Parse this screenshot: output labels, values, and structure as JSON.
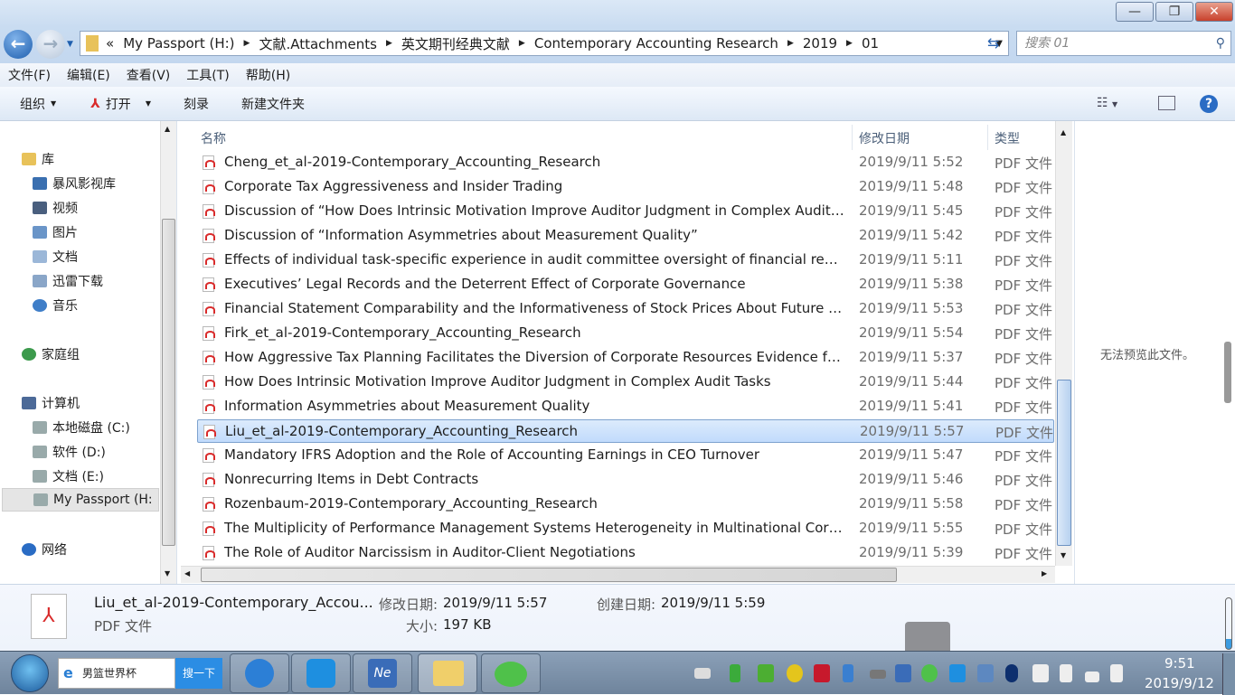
{
  "address": {
    "parts": [
      "«",
      "My Passport (H:)",
      "文献.Attachments",
      "英文期刊经典文献",
      "Contemporary Accounting Research",
      "2019",
      "01"
    ],
    "search_placeholder": "搜索 01"
  },
  "menu": [
    "文件(F)",
    "编辑(E)",
    "查看(V)",
    "工具(T)",
    "帮助(H)"
  ],
  "toolbar": {
    "organize": "组织",
    "open": "打开",
    "burn": "刻录",
    "new_folder": "新建文件夹"
  },
  "nav": {
    "library": "库",
    "lib_items": [
      "暴风影视库",
      "视频",
      "图片",
      "文档",
      "迅雷下载",
      "音乐"
    ],
    "homegroup": "家庭组",
    "computer": "计算机",
    "drives": [
      "本地磁盘 (C:)",
      "软件 (D:)",
      "文档 (E:)",
      "My Passport (H:"
    ],
    "network": "网络"
  },
  "columns": {
    "name": "名称",
    "date": "修改日期",
    "type": "类型"
  },
  "files": [
    {
      "name": "Cheng_et_al-2019-Contemporary_Accounting_Research",
      "date": "2019/9/11 5:52",
      "type": "PDF 文件"
    },
    {
      "name": "Corporate Tax Aggressiveness and Insider Trading",
      "date": "2019/9/11 5:48",
      "type": "PDF 文件"
    },
    {
      "name": "Discussion of “How Does Intrinsic Motivation Improve Auditor Judgment in Complex Audit ...",
      "date": "2019/9/11 5:45",
      "type": "PDF 文件"
    },
    {
      "name": "Discussion of “Information Asymmetries about Measurement Quality”",
      "date": "2019/9/11 5:42",
      "type": "PDF 文件"
    },
    {
      "name": "Effects of individual task-specific experience in audit committee oversight of financial reporti...",
      "date": "2019/9/11 5:11",
      "type": "PDF 文件"
    },
    {
      "name": "Executives’ Legal Records and the Deterrent Effect of Corporate Governance",
      "date": "2019/9/11 5:38",
      "type": "PDF 文件"
    },
    {
      "name": "Financial Statement Comparability and the Informativeness of Stock Prices About Future Earn...",
      "date": "2019/9/11 5:53",
      "type": "PDF 文件"
    },
    {
      "name": "Firk_et_al-2019-Contemporary_Accounting_Research",
      "date": "2019/9/11 5:54",
      "type": "PDF 文件"
    },
    {
      "name": "How Aggressive Tax Planning Facilitates the Diversion of Corporate Resources Evidence fro...",
      "date": "2019/9/11 5:37",
      "type": "PDF 文件"
    },
    {
      "name": "How Does Intrinsic Motivation Improve Auditor Judgment in Complex Audit Tasks",
      "date": "2019/9/11 5:44",
      "type": "PDF 文件"
    },
    {
      "name": "Information Asymmetries about Measurement Quality",
      "date": "2019/9/11 5:41",
      "type": "PDF 文件"
    },
    {
      "name": "Liu_et_al-2019-Contemporary_Accounting_Research",
      "date": "2019/9/11 5:57",
      "type": "PDF 文件",
      "selected": true
    },
    {
      "name": "Mandatory IFRS Adoption and the Role of Accounting Earnings in CEO Turnover",
      "date": "2019/9/11 5:47",
      "type": "PDF 文件"
    },
    {
      "name": "Nonrecurring Items in Debt Contracts",
      "date": "2019/9/11 5:46",
      "type": "PDF 文件"
    },
    {
      "name": "Rozenbaum-2019-Contemporary_Accounting_Research",
      "date": "2019/9/11 5:58",
      "type": "PDF 文件"
    },
    {
      "name": "The Multiplicity of Performance Management Systems Heterogeneity in Multinational Corpo...",
      "date": "2019/9/11 5:55",
      "type": "PDF 文件"
    },
    {
      "name": "The Role of Auditor Narcissism in Auditor-Client Negotiations",
      "date": "2019/9/11 5:39",
      "type": "PDF 文件"
    }
  ],
  "preview": {
    "message": "无法预览此文件。"
  },
  "details": {
    "filename": "Liu_et_al-2019-Contemporary_Accou...",
    "filetype": "PDF 文件",
    "modified_label": "修改日期:",
    "modified": "2019/9/11 5:57",
    "created_label": "创建日期:",
    "created": "2019/9/11 5:59",
    "size_label": "大小:",
    "size": "197 KB"
  },
  "taskbar": {
    "search_text": "男篮世界杯",
    "search_btn": "搜一下",
    "time": "9:51",
    "date": "2019/9/12"
  },
  "colors": {
    "accent": "#3399ff",
    "selection": "#c1dbfc"
  }
}
